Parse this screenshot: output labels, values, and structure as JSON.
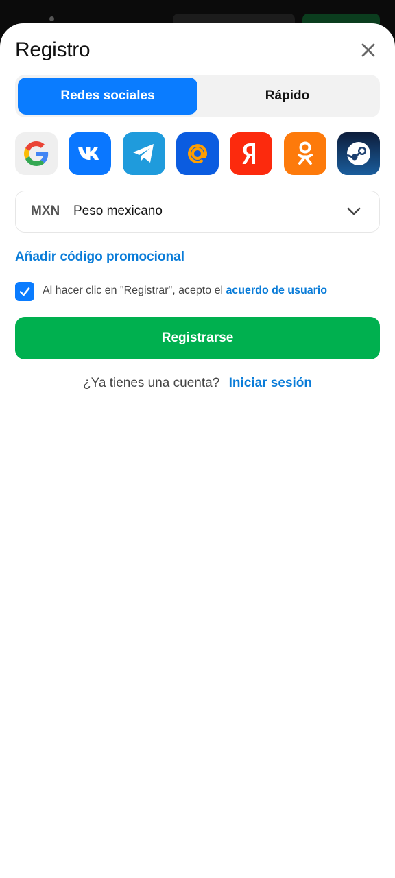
{
  "modal": {
    "title": "Registro"
  },
  "tabs": [
    {
      "label": "Redes sociales",
      "active": true
    },
    {
      "label": "Rápido",
      "active": false
    }
  ],
  "social_providers": [
    {
      "name": "google",
      "icon": "google-icon",
      "bg": "#efefef"
    },
    {
      "name": "vk",
      "icon": "vk-icon",
      "bg": "#0a77ff"
    },
    {
      "name": "telegram",
      "icon": "telegram-icon",
      "bg": "#1f9bdc"
    },
    {
      "name": "mail",
      "icon": "at-sign-icon",
      "bg": "#0b5ce0"
    },
    {
      "name": "yandex",
      "icon": "yandex-icon",
      "bg": "#fc2a0d"
    },
    {
      "name": "odnoklassniki",
      "icon": "odnoklassniki-icon",
      "bg": "#fd7a0b"
    },
    {
      "name": "steam",
      "icon": "steam-icon",
      "bg": "#14294d"
    }
  ],
  "currency": {
    "code": "MXN",
    "name": "Peso mexicano"
  },
  "promo_link": "Añadir código promocional",
  "agreement": {
    "checked": true,
    "text": "Al hacer clic en \"Registrar\", acepto el",
    "link": "acuerdo de usuario"
  },
  "register_button": "Registrarse",
  "login": {
    "prompt": "¿Ya tienes una cuenta?",
    "link": "Iniciar sesión"
  },
  "colors": {
    "accent_blue": "#0a7cff",
    "link_blue": "#0a7cd8",
    "register_green": "#00b04f"
  }
}
